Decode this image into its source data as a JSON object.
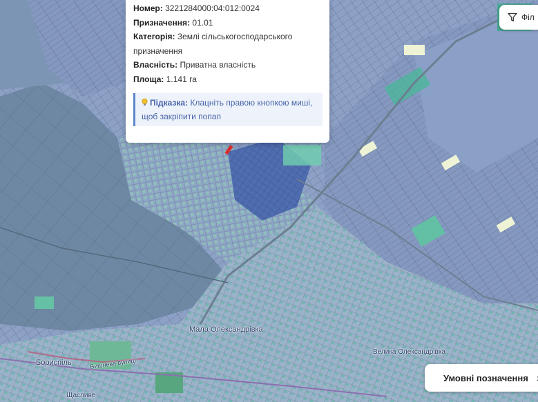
{
  "popup": {
    "number_label": "Номер:",
    "number_value": "3221284000:04:012:0024",
    "purpose_label": "Призначення:",
    "purpose_value": "01.01",
    "category_label": "Категорія:",
    "category_value_1": "Землі сільськогосподарського",
    "category_value_2": "призначення",
    "ownership_label": "Власність:",
    "ownership_value": "Приватна власність",
    "area_label": "Площа:",
    "area_value": "1.141 га",
    "hint_label": "Підказка:",
    "hint_text_1": "Клацніть правою кнопкою миші,",
    "hint_text_2": "щоб закріпити попап"
  },
  "filter_button": {
    "label": "Філ",
    "icon": "filter-icon"
  },
  "legend_button": {
    "label": "Умовні позначення",
    "icon": "chevron-right-icon"
  },
  "map_labels": {
    "village_center": "Мала Олександрівка",
    "village_left": "Бориспіль",
    "street": "Вишнева вулиця",
    "village_right": "Велика Олександрівка",
    "bottom_left": "Щасливе"
  },
  "colors": {
    "parcel_blue": "#8fa3c8",
    "parcel_dark": "#4f6db0",
    "parcel_teal": "#4bb59a",
    "parcel_green": "#7ed0b0",
    "parcel_cream": "#eef3d6",
    "forest": "#6f8aa6",
    "road": "#7a8d9c"
  }
}
